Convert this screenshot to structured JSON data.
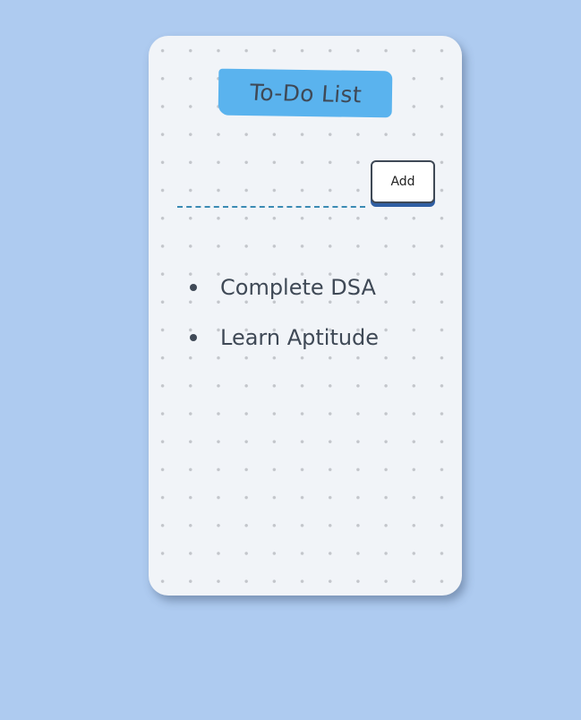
{
  "app": {
    "title": "To-Do List"
  },
  "input": {
    "value": "",
    "placeholder": ""
  },
  "add_button": {
    "label": "Add"
  },
  "todos": [
    {
      "text": "Complete DSA"
    },
    {
      "text": "Learn Aptitude"
    }
  ],
  "colors": {
    "background": "#aecbf0",
    "card": "#f1f4f8",
    "title_highlight": "#5ab3ee",
    "text": "#3f4956",
    "input_underline": "#3a8bb3",
    "button_shadow": "#2f5ea3"
  }
}
